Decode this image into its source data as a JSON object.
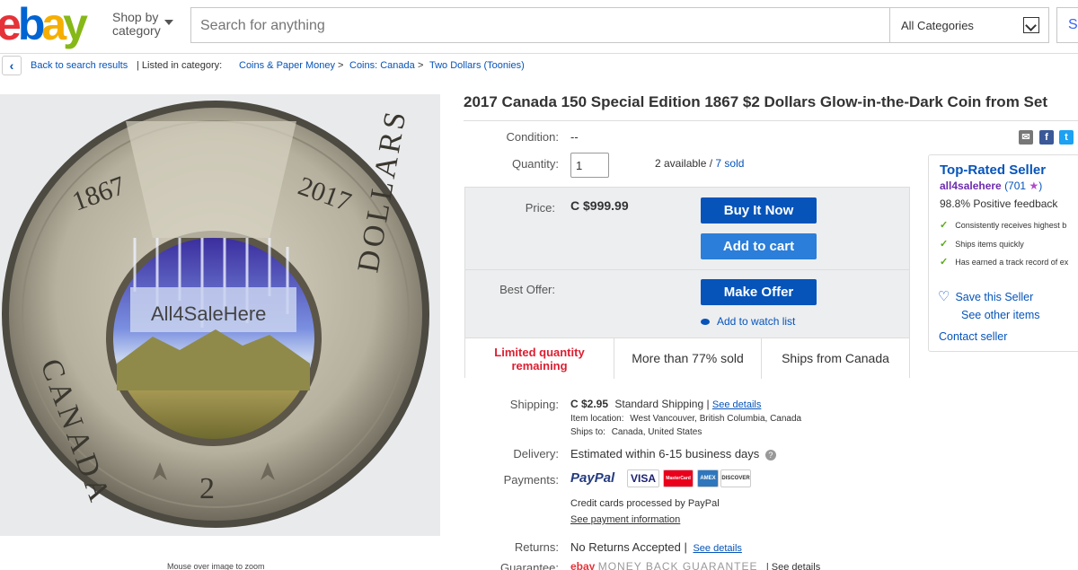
{
  "header": {
    "shop_by": "Shop by",
    "category": "category",
    "search_placeholder": "Search for anything",
    "category_select": "All Categories",
    "search_button": "S"
  },
  "breadcrumb": {
    "back": "Back to search results",
    "listed_in": "| Listed in category:",
    "items": [
      "Coins & Paper Money",
      "Coins: Canada",
      "Two Dollars (Toonies)"
    ],
    "sep": ">"
  },
  "image": {
    "caption": "Mouse over image to zoom",
    "watermark": "All4SaleHere",
    "coin_year_left": "1867",
    "coin_year_right": "2017",
    "coin_left_text": "CANADA",
    "coin_right_text": "DOLLARS",
    "coin_denom": "2"
  },
  "listing": {
    "title": "2017 Canada 150 Special Edition 1867 $2 Dollars Glow-in-the-Dark Coin from Set",
    "condition_label": "Condition:",
    "condition_value": "--",
    "quantity_label": "Quantity:",
    "quantity_value": "1",
    "available": "2 available /",
    "sold": "7 sold"
  },
  "buybox": {
    "price_label": "Price:",
    "price": "C $999.99",
    "buy_now": "Buy It Now",
    "add_to_cart": "Add to cart",
    "best_offer_label": "Best Offer:",
    "make_offer": "Make Offer",
    "watch": "Add to watch list",
    "tiles": [
      "Limited quantity remaining",
      "More than 77% sold",
      "Ships from Canada"
    ]
  },
  "seller": {
    "heading": "Top-Rated Seller",
    "name": "all4salehere",
    "score": "(701",
    "score_close": ")",
    "feedback": "98.8% Positive feedback",
    "checks": [
      "Consistently receives highest b",
      "Ships items quickly",
      "Has earned a track record of ex"
    ],
    "save": "Save this Seller",
    "other_items": "See other items",
    "contact": "Contact seller"
  },
  "shipping": {
    "label": "Shipping:",
    "cost": "C $2.95",
    "method": "Standard Shipping |",
    "details": "See details",
    "location_label": "Item location:",
    "location": "West Vancouver, British Columbia, Canada",
    "ships_to_label": "Ships to:",
    "ships_to": "Canada, United States"
  },
  "delivery": {
    "label": "Delivery:",
    "value": "Estimated within 6-15 business days"
  },
  "payments": {
    "label": "Payments:",
    "paypal": "PayPal",
    "visa": "VISA",
    "mc": "MasterCard",
    "amex": "AMEX",
    "discover": "DISCOVER",
    "credit_note": "Credit cards processed by PayPal",
    "info": "See payment information"
  },
  "returns": {
    "label": "Returns:",
    "value": "No Returns Accepted |",
    "details": "See details"
  },
  "guarantee": {
    "label": "Guarantee:",
    "value": "MONEY BACK GUARANTEE",
    "details": "| See details"
  },
  "colors": {
    "link": "#0654ba",
    "button": "#0654ba",
    "urgent": "#dd1e31"
  }
}
